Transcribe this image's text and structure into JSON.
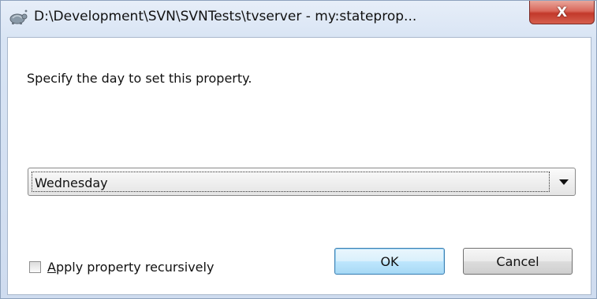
{
  "window": {
    "title": "D:\\Development\\SVN\\SVNTests\\tvserver - my:stateprop...",
    "close_glyph": "X",
    "app_icon": "tortoise-icon"
  },
  "dialog": {
    "prompt": "Specify the day to set this property.",
    "day_select": {
      "value": "Wednesday"
    },
    "recursive_checkbox": {
      "label_mnemonic": "A",
      "label_rest": "pply property recursively",
      "checked": false
    },
    "ok_label": "OK",
    "cancel_label": "Cancel"
  },
  "colors": {
    "close_button": "#c2392b",
    "default_button_border": "#3c7fb1"
  }
}
